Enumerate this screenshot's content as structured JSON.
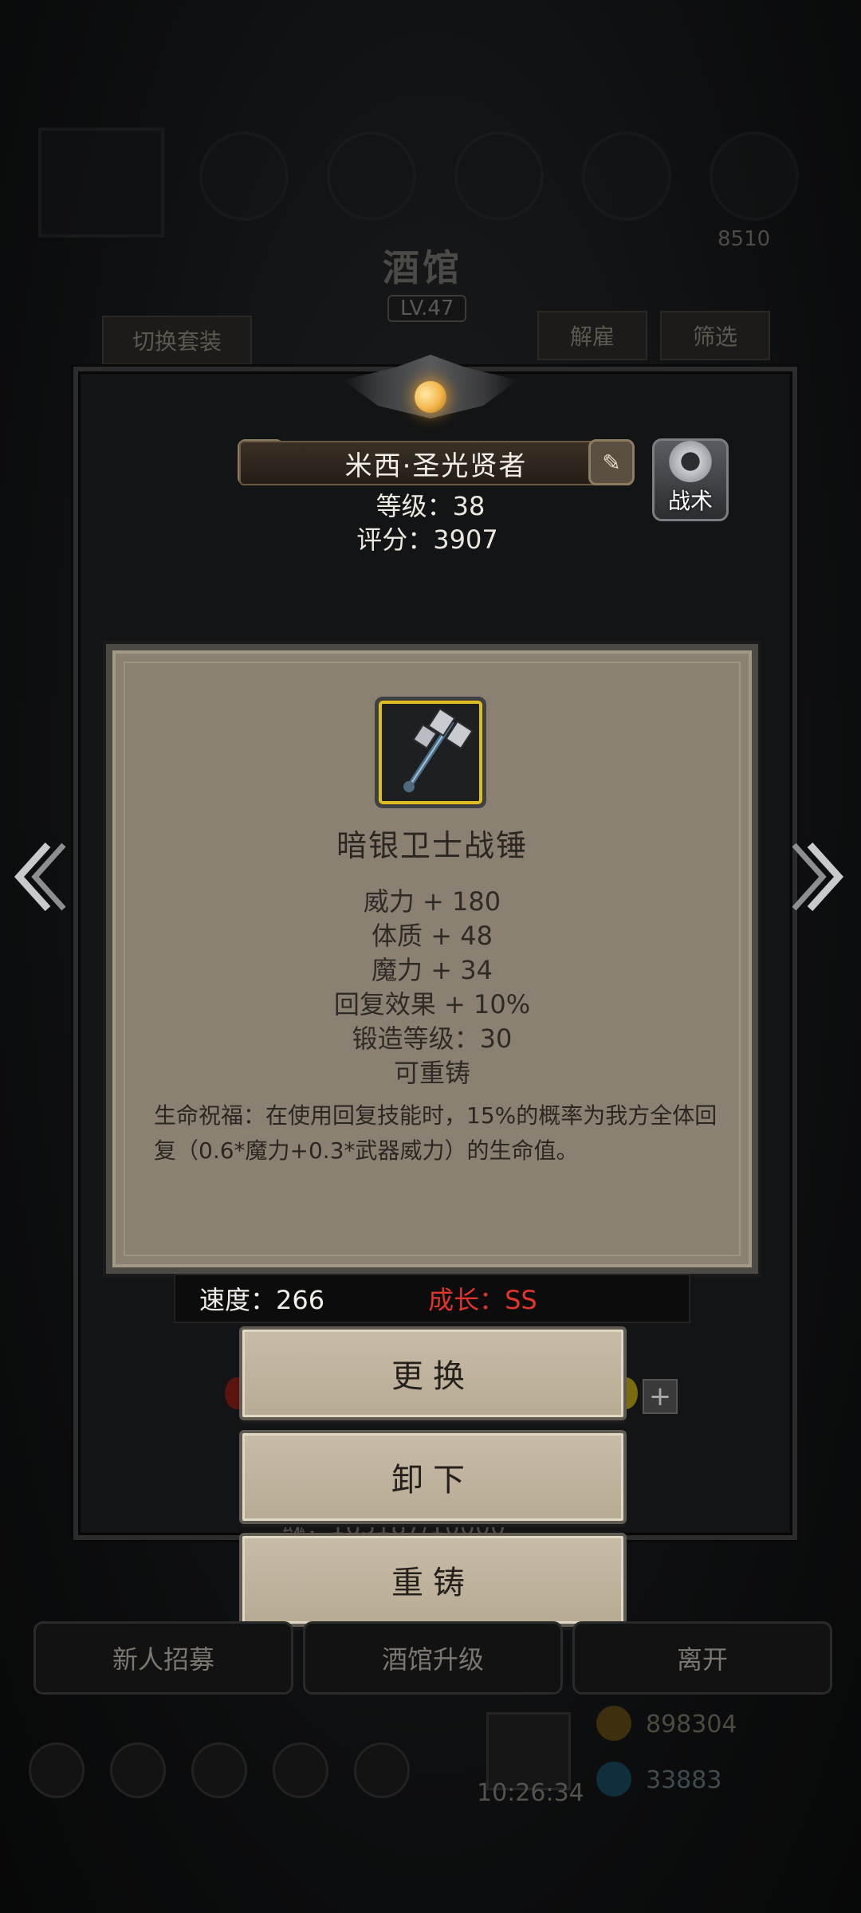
{
  "background": {
    "title": "酒馆",
    "level": "LV.47",
    "switch_outfit": "切换套装",
    "dismiss": "解雇",
    "filter": "筛选",
    "score_partial": "8510",
    "hp_partial": "魂：165187/10000",
    "time": "10:26:34",
    "gold": "898304",
    "gems": "33883"
  },
  "hero": {
    "name": "米西·圣光贤者",
    "level_line": "等级：38",
    "score_line": "评分：3907",
    "tactics_label": "战术",
    "speed": "速度：266",
    "growth": "成长：SS"
  },
  "item": {
    "name": "暗银卫士战锤",
    "stats": [
      "威力 + 180",
      "体质 + 48",
      "魔力 + 34",
      "回复效果 + 10%",
      "锻造等级：30",
      "可重铸"
    ],
    "description": "生命祝福：在使用回复技能时，15%的概率为我方全体回复（0.6*魔力+0.3*武器威力）的生命值。",
    "frame_color": "#e0bd1e"
  },
  "actions": {
    "replace": "更换",
    "unequip": "卸下",
    "reforge": "重铸"
  },
  "bottom": {
    "recruit": "新人招募",
    "upgrade": "酒馆升级",
    "leave": "离开"
  },
  "colors": {
    "growth": "#e0352a",
    "popup_bg": "#8a8172",
    "button_bg": "#c8bca7"
  }
}
